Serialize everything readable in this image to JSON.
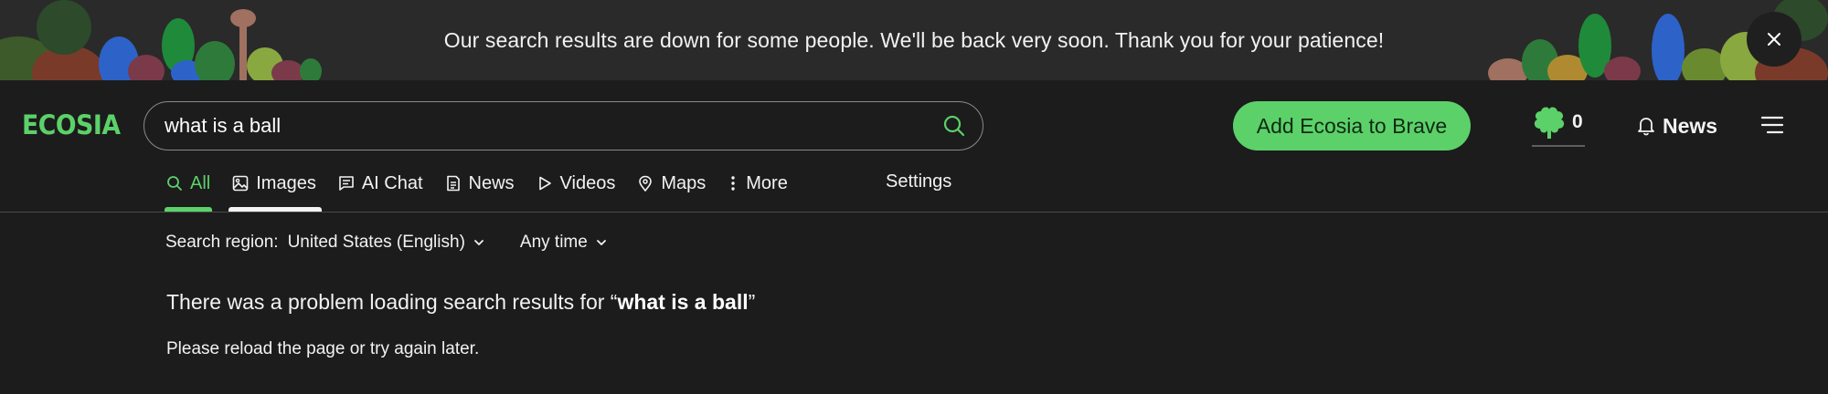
{
  "banner": {
    "message": "Our search results are down for some people. We'll be back very soon. Thank you for your patience!",
    "close_icon": "close-icon"
  },
  "header": {
    "logo": "ECOSIA",
    "search": {
      "value": "what is a ball",
      "icon": "search-icon"
    },
    "cta_label": "Add Ecosia to Brave",
    "tree_count": "0",
    "news_label": "News",
    "menu_icon": "hamburger-menu-icon"
  },
  "tabs": [
    {
      "label": "All",
      "icon": "search-icon",
      "active": true
    },
    {
      "label": "Images",
      "icon": "image-icon"
    },
    {
      "label": "AI Chat",
      "icon": "chat-icon"
    },
    {
      "label": "News",
      "icon": "news-icon"
    },
    {
      "label": "Videos",
      "icon": "play-icon"
    },
    {
      "label": "Maps",
      "icon": "map-pin-icon"
    },
    {
      "label": "More",
      "icon": "more-vertical-icon"
    }
  ],
  "settings_label": "Settings",
  "filters": {
    "region_label": "Search region:",
    "region_value": "United States (English)",
    "time_value": "Any time"
  },
  "error": {
    "prefix": "There was a problem loading search results for “",
    "query": "what is a ball",
    "suffix": "”",
    "subtitle": "Please reload the page or try again later."
  },
  "colors": {
    "accent": "#5cd16a",
    "background": "#1c1c1c",
    "banner_bg": "#2a2a2a",
    "text": "#f2f2f2"
  }
}
